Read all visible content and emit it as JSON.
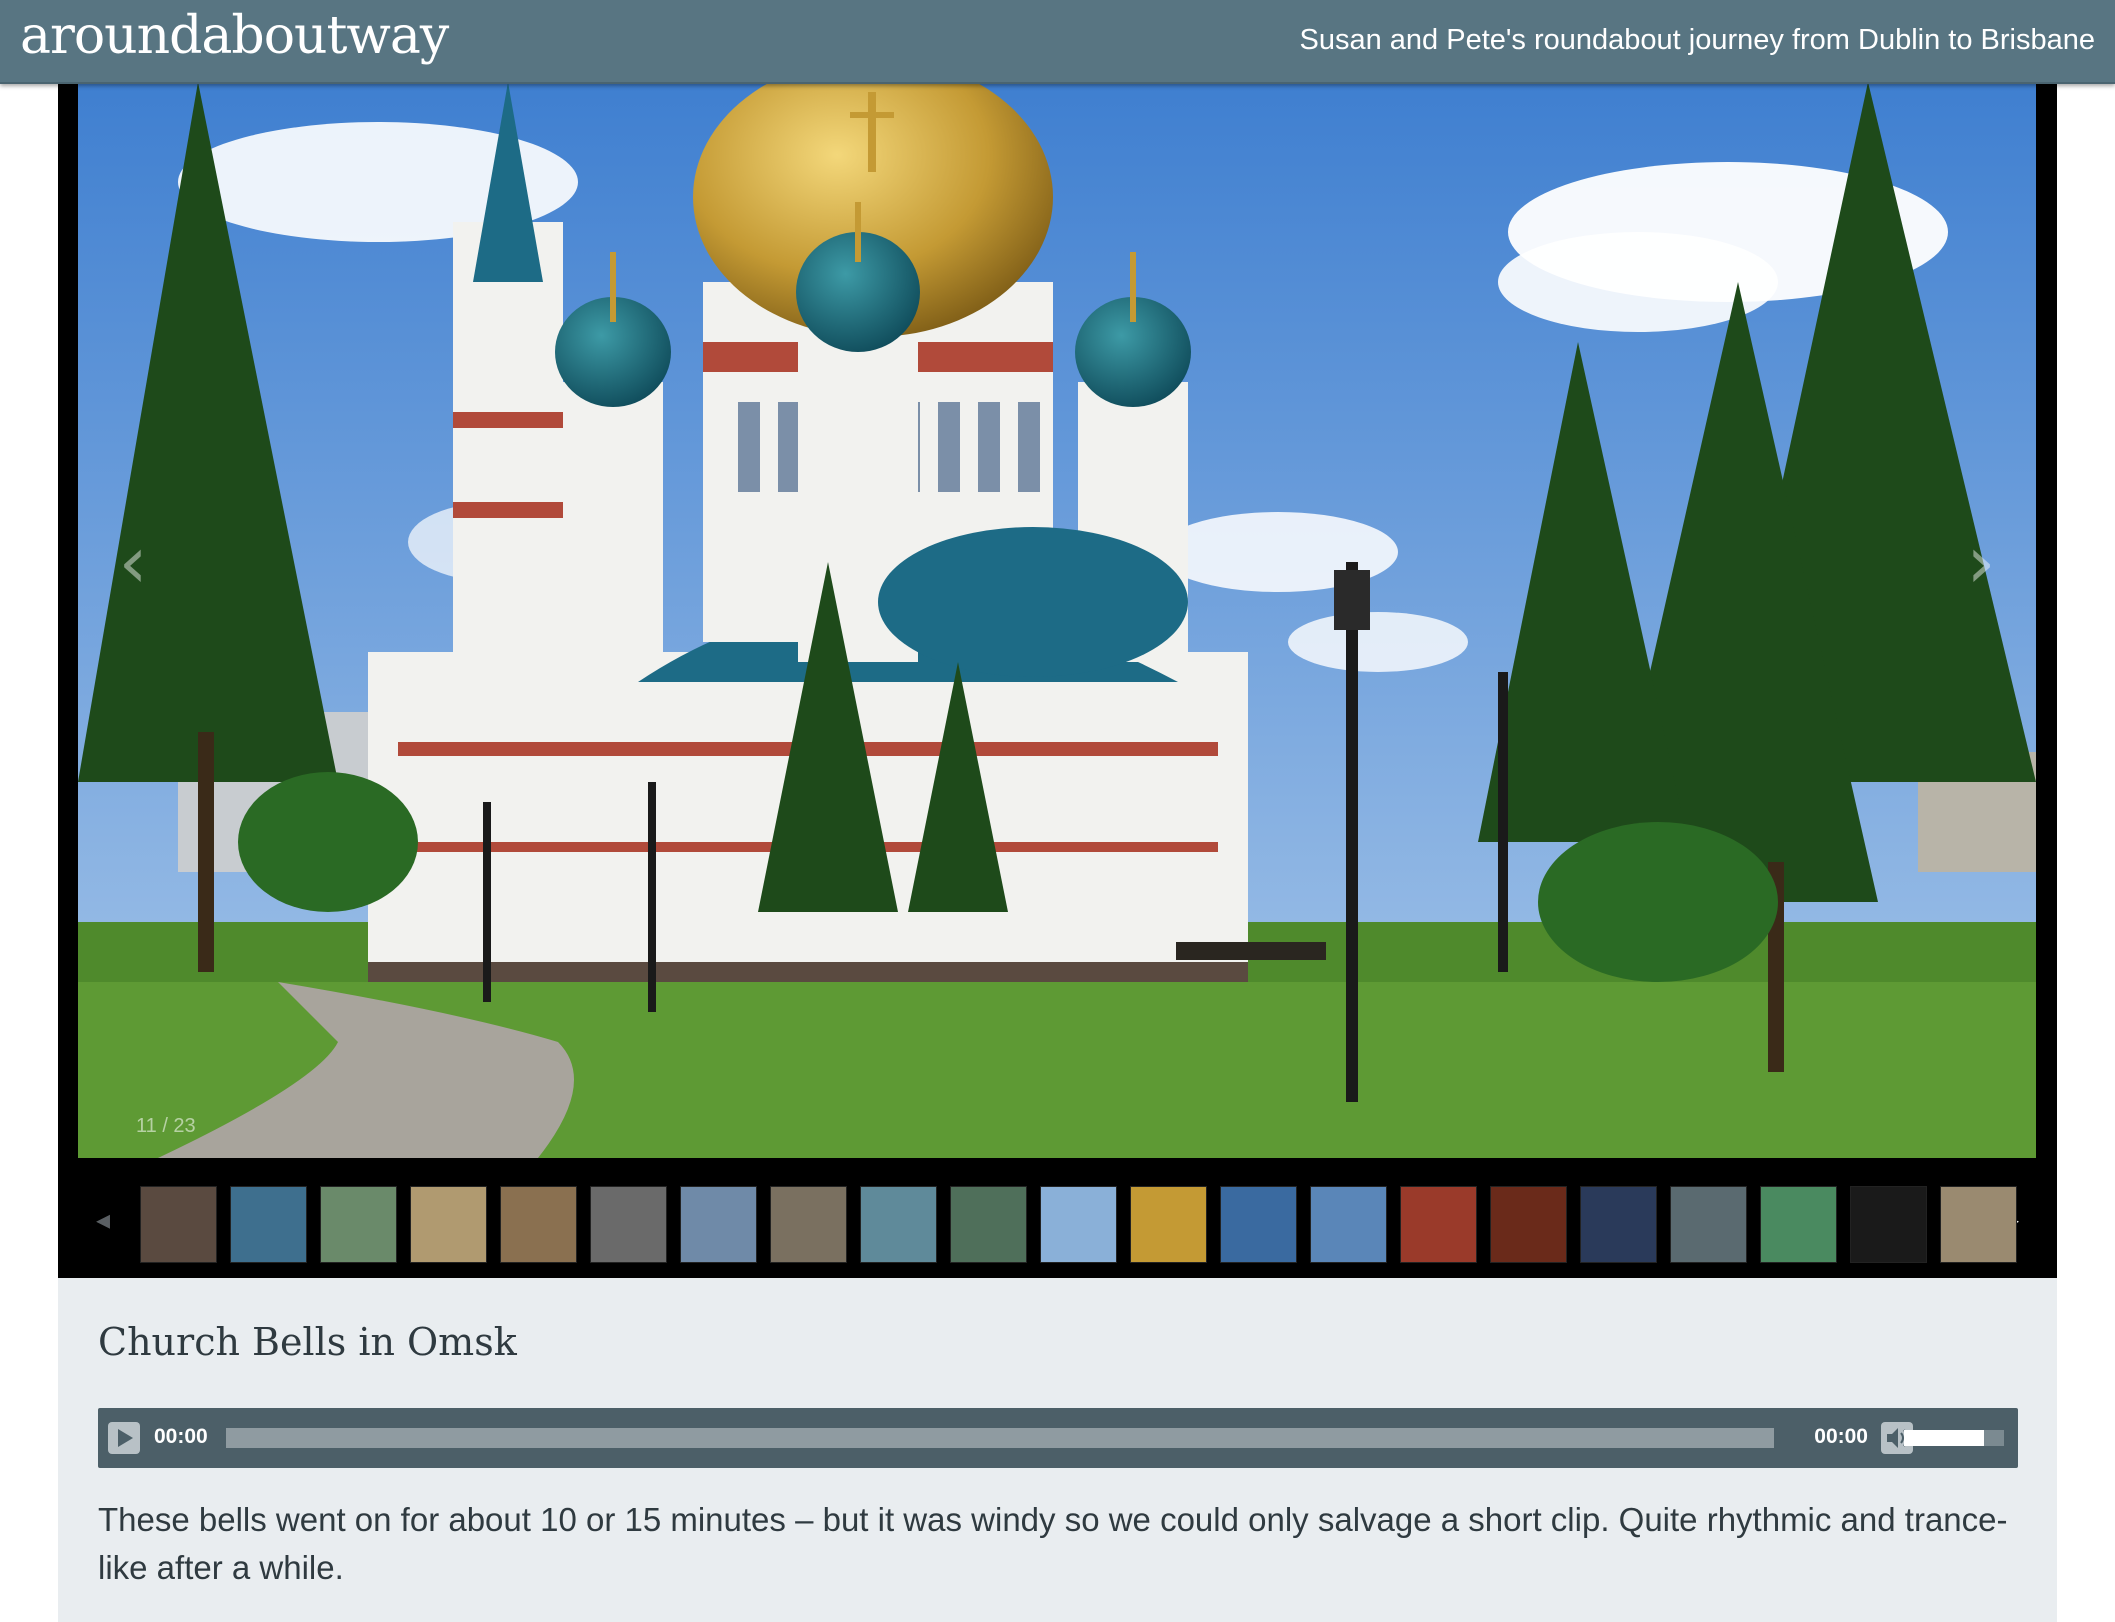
{
  "header": {
    "site_title": "aroundaboutway",
    "tagline": "Susan and Pete's roundabout journey from Dublin to Brisbane"
  },
  "gallery": {
    "counter": "11 / 23",
    "prev_arrow": "‹",
    "next_arrow": "›",
    "strip_prev": "◂",
    "strip_next": "▸",
    "thumbnail_count": 21
  },
  "post": {
    "title": "Church Bells in Omsk",
    "body": "These bells went on for about 10 or 15 minutes – but it was windy so we could only salvage a short clip. Quite rhythmic and trance-like after a while."
  },
  "audio": {
    "current_time": "00:00",
    "total_time": "00:00",
    "volume": 0.8
  },
  "colors": {
    "header_bg": "#587582",
    "panel_bg": "#e9edf0",
    "player_bg": "#4c5f68"
  }
}
